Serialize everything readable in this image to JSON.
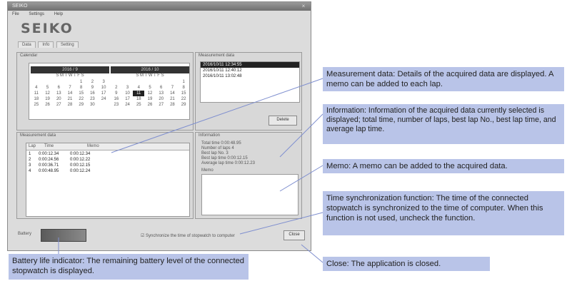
{
  "window": {
    "title": "SEIKO",
    "menu": [
      "File",
      "Settings",
      "Help"
    ],
    "brand": "SEIKO",
    "tabs": [
      "Data",
      "Info",
      "Setting"
    ],
    "close_glyph": "×"
  },
  "calendar": {
    "label": "Calendar",
    "months": [
      "2016 / 9",
      "2016 / 10"
    ],
    "weekday": "S M T W T F S",
    "days_left": [
      "",
      "",
      "",
      "",
      "1",
      "2",
      "3",
      "4",
      "5",
      "6",
      "7",
      "8",
      "9",
      "10",
      "11",
      "12",
      "13",
      "14",
      "15",
      "16",
      "17",
      "18",
      "19",
      "20",
      "21",
      "22",
      "23",
      "24",
      "25",
      "26",
      "27",
      "28",
      "29",
      "30",
      ""
    ],
    "days_right": [
      "",
      "",
      "",
      "",
      "",
      "",
      "1",
      "2",
      "3",
      "4",
      "5",
      "6",
      "7",
      "8",
      "9",
      "10",
      "11",
      "12",
      "13",
      "14",
      "15",
      "16",
      "17",
      "18",
      "19",
      "20",
      "21",
      "22",
      "23",
      "24",
      "25",
      "26",
      "27",
      "28",
      "29"
    ]
  },
  "data_list": {
    "label": "Measurement data",
    "rows": [
      "2016/10/11 12:34:55",
      "2016/10/11 12:40:12",
      "2016/10/11 13:02:48"
    ],
    "button": "Delete"
  },
  "lap_table": {
    "label": "Measurement data",
    "headers": [
      "Lap",
      "Time",
      "Memo"
    ],
    "rows": [
      [
        "1",
        "0:00:12.34",
        "0:00:12.34"
      ],
      [
        "2",
        "0:00:24.56",
        "0:00:12.22"
      ],
      [
        "3",
        "0:00:36.71",
        "0:00:12.15"
      ],
      [
        "4",
        "0:00:48.95",
        "0:00:12.24"
      ]
    ]
  },
  "info_panel": {
    "label": "Information",
    "lines": [
      "Total time  0:00:48.95",
      "Number of laps  4",
      "Best lap No.  3",
      "Best lap time  0:00:12.15",
      "Average lap time  0:00:12.23"
    ],
    "memo_label": "Memo"
  },
  "footer": {
    "battery_label": "Battery",
    "sync_label": "Synchronize the time of stopwatch to computer",
    "close_button": "Close"
  },
  "callouts": {
    "measurement": "Measurement data: Details of the acquired data are displayed. A memo can be added to each lap.",
    "information": "Information: Information of the acquired data currently selected is displayed; total time, number of laps, best lap No., best lap time, and average lap time.",
    "memo": "Memo: A memo can be added to the acquired data.",
    "sync": "Time synchronization function: The time of the connected stopwatch is synchronized to the time of computer. When this function is not used, uncheck the function.",
    "battery": "Battery life indicator: The remaining battery level of the connected stopwatch is displayed.",
    "close": "Close: The application is closed."
  },
  "colors": {
    "callout_bg": "#b9c4e8",
    "callout_line": "#7f8fcf"
  }
}
